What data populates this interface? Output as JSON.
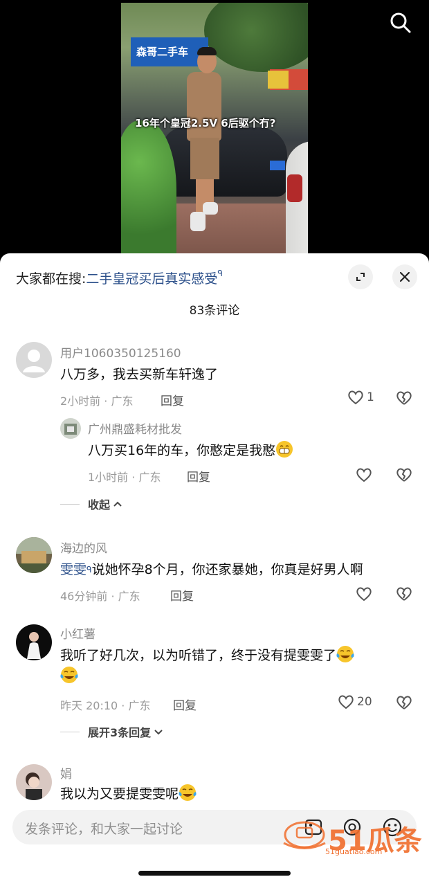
{
  "video": {
    "caption": "16年个皇冠2.5V 6后驱个冇?",
    "shop_sign": "森哥二手车",
    "accent_color": "#1f5fb8"
  },
  "hot_search": {
    "prefix": "大家都在搜:",
    "query": "二手皇冠买后真实感受"
  },
  "comments_title": "83条评论",
  "comments": [
    {
      "user": "用户1060350125160",
      "text": "八万多，我去买新车轩逸了",
      "time": "2小时前",
      "location": "广东",
      "reply_label": "回复",
      "likes": "1"
    },
    {
      "user": "广州鼎盛耗材批发",
      "text": "八万买16年的车，你憨定是我憨",
      "time": "1小时前",
      "location": "广东",
      "reply_label": "回复",
      "likes": ""
    },
    {
      "user": "海边的风",
      "mention": "雯雯",
      "text": "说她怀孕8个月，你还家暴她，你真是好男人啊",
      "time": "46分钟前",
      "location": "广东",
      "reply_label": "回复",
      "likes": ""
    },
    {
      "user": "小红薯",
      "text": "我听了好几次，以为听错了，终于没有提雯雯了",
      "time": "昨天 20:10",
      "location": "广东",
      "reply_label": "回复",
      "likes": "20"
    },
    {
      "user": "娟",
      "text": "我以为又要提雯雯呢"
    }
  ],
  "collapse_label": "收起",
  "expand_replies_label": "展开3条回复",
  "meta_separator": "·",
  "input": {
    "placeholder": "发条评论，和大家一起讨论"
  },
  "watermark": {
    "text": "51瓜条",
    "sub": "51guatiao.com"
  }
}
